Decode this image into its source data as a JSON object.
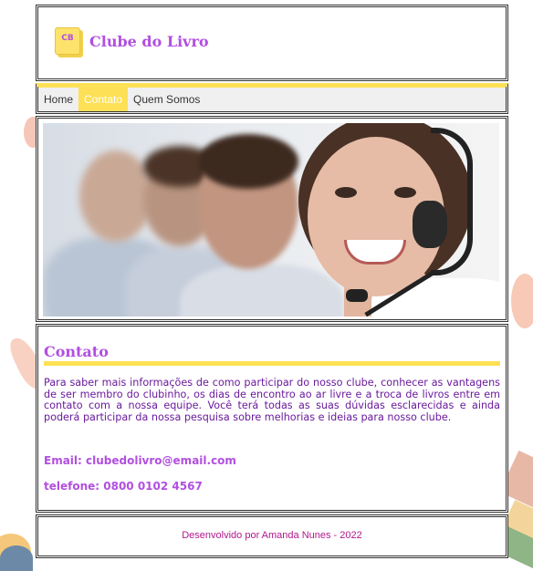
{
  "brand": {
    "logo_initials": "CB",
    "name": "Clube do Livro",
    "color": "#b14fe0",
    "accent": "#fde055"
  },
  "nav": {
    "items": [
      {
        "label": "Home",
        "active": false
      },
      {
        "label": "Contato",
        "active": true
      },
      {
        "label": "Quem Somos",
        "active": false
      }
    ]
  },
  "hero": {
    "icon": "headset-support-photo"
  },
  "contact": {
    "title": "Contato",
    "paragraph": "Para saber mais informações de como participar do nosso clube, conhecer as vantagens de ser membro do clubinho, os dias de encontro ao ar livre e a troca de livros entre em contato com a nossa equipe. Você terá todas as suas dúvidas esclarecidas e ainda poderá participar da nossa pesquisa sobre melhorias e ideias para nosso clube.",
    "email": "Email: clubedolivro@email.com",
    "phone": "telefone: 0800 0102 4567"
  },
  "footer": {
    "text": "Desenvolvido por Amanda Nunes - 2022"
  }
}
